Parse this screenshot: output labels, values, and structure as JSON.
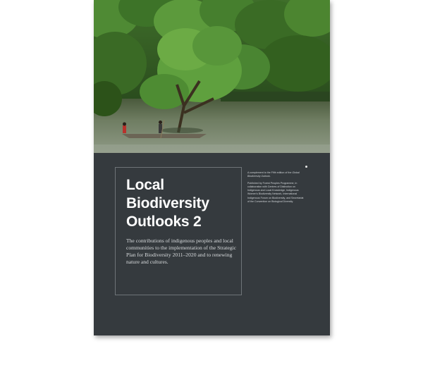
{
  "cover": {
    "title_lines": [
      "Local",
      "Biodiversity",
      "Outlooks 2"
    ],
    "subtitle": "The contributions of indigenous peoples and local communities to the implementation of the Strategic Plan for Biodiversity 2011–2020 and to renewing nature and cultures.",
    "complement": {
      "prefix": "A complement to the Fifth edition of the ",
      "italic": "Global Biodiversity Outlook",
      "suffix": "."
    },
    "published_by": "Published by Forest Peoples Programme, in collaboration with Centres of Distinction on Indigenous and Local Knowledge, Indigenous Women's Biodiversity Network, International Indigenous Forum on Biodiversity, and Secretariat of the Convention on Biological Diversity."
  },
  "colors": {
    "panel": "#353a3e",
    "title": "#ffffff",
    "frame": "#6e7478"
  }
}
